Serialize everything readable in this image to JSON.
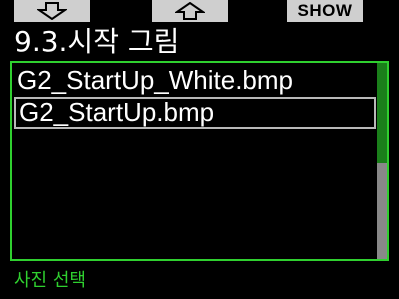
{
  "softkeys": {
    "left_icon": "arrow-down-icon",
    "middle_icon": "arrow-up-icon",
    "right_label": "SHOW"
  },
  "screen": {
    "title": "9.3.시작 그림"
  },
  "list": {
    "items": [
      {
        "label": "G2_StartUp_White.bmp",
        "selected": false
      },
      {
        "label": "G2_StartUp.bmp",
        "selected": true
      }
    ]
  },
  "status": {
    "hint": "사진 선택"
  },
  "colors": {
    "accent": "#2fd02f",
    "softkey_bg": "#cfcfcf",
    "selection_border": "#b8b8b8",
    "scroll_thumb": "#1a7f1a",
    "scroll_track": "#888888",
    "background": "#000000"
  }
}
